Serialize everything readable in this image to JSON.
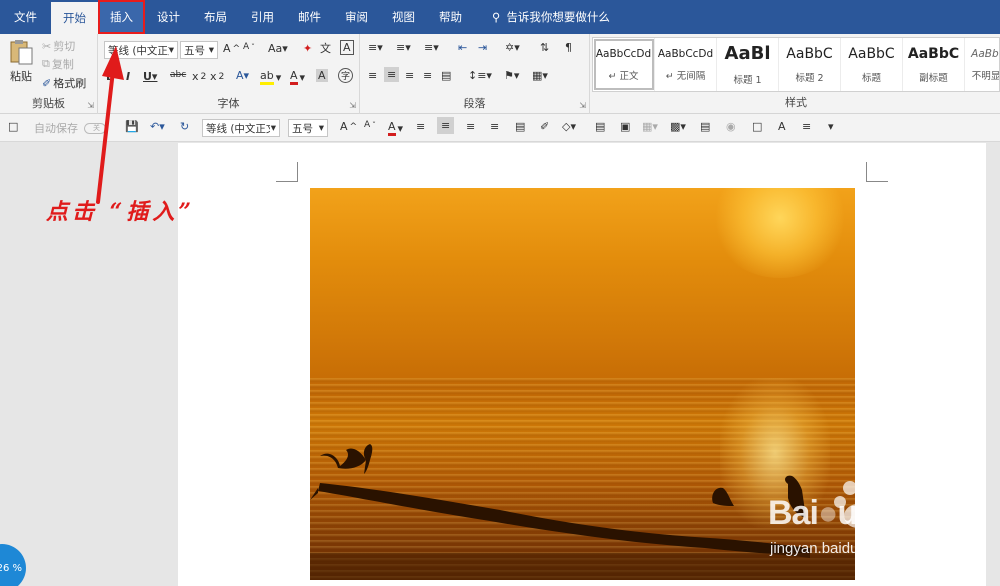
{
  "tabs": [
    "文件",
    "开始",
    "插入",
    "设计",
    "布局",
    "引用",
    "邮件",
    "审阅",
    "视图",
    "帮助"
  ],
  "tell_me": "告诉我你想要做什么",
  "clipboard": {
    "paste": "粘贴",
    "cut": "剪切",
    "copy": "复制",
    "format_painter": "格式刷",
    "label": "剪贴板"
  },
  "font": {
    "name": "等线 (中文正文)",
    "size": "五号",
    "label": "字体"
  },
  "paragraph": {
    "label": "段落"
  },
  "styles": {
    "label": "样式",
    "items": [
      {
        "sample": "AaBbCcDd",
        "name": "↵ 正文"
      },
      {
        "sample": "AaBbCcDd",
        "name": "↵ 无间隔"
      },
      {
        "sample": "AaBl",
        "name": "标题 1"
      },
      {
        "sample": "AaBbC",
        "name": "标题 2"
      },
      {
        "sample": "AaBbC",
        "name": "标题"
      },
      {
        "sample": "AaBbC",
        "name": "副标题"
      },
      {
        "sample": "AaBbCcD",
        "name": "不明显强调"
      }
    ]
  },
  "qat": {
    "autosave": "自动保存",
    "autosave_state": "关",
    "font_name": "等线 (中文正文)",
    "font_size": "五号"
  },
  "annotation": "点击 “插入”",
  "zoom": "26 %",
  "colors": {
    "accent": "#2b579a",
    "annotation": "#e01b1b"
  }
}
